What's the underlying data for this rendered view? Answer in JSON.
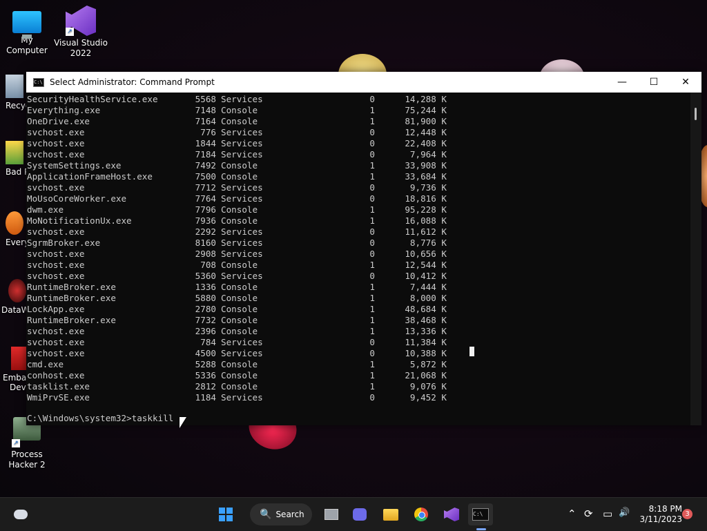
{
  "desktop": {
    "icons": [
      {
        "label_line1": "My Computer",
        "label_line2": ""
      },
      {
        "label_line1": "Visual Studio",
        "label_line2": "2022"
      },
      {
        "label_line1": "Process",
        "label_line2": "Hacker 2"
      }
    ],
    "partial_labels": [
      "Recyc",
      "Bad P",
      "Every",
      "DataW",
      "Embar",
      "Dev"
    ]
  },
  "window": {
    "title": "Select Administrator:  Command Prompt",
    "icon_glyph": "C:\\",
    "minimize_glyph": "—",
    "maximize_glyph": "☐",
    "close_glyph": "✕"
  },
  "console": {
    "rows": [
      [
        "SecurityHealthService.exe",
        "5568",
        "Services",
        "0",
        "14,288 K"
      ],
      [
        "Everything.exe",
        "7148",
        "Console",
        "1",
        "75,244 K"
      ],
      [
        "OneDrive.exe",
        "7164",
        "Console",
        "1",
        "81,900 K"
      ],
      [
        "svchost.exe",
        "776",
        "Services",
        "0",
        "12,448 K"
      ],
      [
        "svchost.exe",
        "1844",
        "Services",
        "0",
        "22,408 K"
      ],
      [
        "svchost.exe",
        "7184",
        "Services",
        "0",
        "7,964 K"
      ],
      [
        "SystemSettings.exe",
        "7492",
        "Console",
        "1",
        "33,908 K"
      ],
      [
        "ApplicationFrameHost.exe",
        "7500",
        "Console",
        "1",
        "33,684 K"
      ],
      [
        "svchost.exe",
        "7712",
        "Services",
        "0",
        "9,736 K"
      ],
      [
        "MoUsoCoreWorker.exe",
        "7764",
        "Services",
        "0",
        "18,816 K"
      ],
      [
        "dwm.exe",
        "7796",
        "Console",
        "1",
        "95,228 K"
      ],
      [
        "MoNotificationUx.exe",
        "7936",
        "Console",
        "1",
        "16,088 K"
      ],
      [
        "svchost.exe",
        "2292",
        "Services",
        "0",
        "11,612 K"
      ],
      [
        "SgrmBroker.exe",
        "8160",
        "Services",
        "0",
        "8,776 K"
      ],
      [
        "svchost.exe",
        "2908",
        "Services",
        "0",
        "10,656 K"
      ],
      [
        "svchost.exe",
        "708",
        "Console",
        "1",
        "12,544 K"
      ],
      [
        "svchost.exe",
        "5360",
        "Services",
        "0",
        "10,412 K"
      ],
      [
        "RuntimeBroker.exe",
        "1336",
        "Console",
        "1",
        "7,444 K"
      ],
      [
        "RuntimeBroker.exe",
        "5880",
        "Console",
        "1",
        "8,000 K"
      ],
      [
        "LockApp.exe",
        "2780",
        "Console",
        "1",
        "48,684 K"
      ],
      [
        "RuntimeBroker.exe",
        "7732",
        "Console",
        "1",
        "38,468 K"
      ],
      [
        "svchost.exe",
        "2396",
        "Console",
        "1",
        "13,336 K"
      ],
      [
        "svchost.exe",
        "784",
        "Services",
        "0",
        "11,384 K"
      ],
      [
        "svchost.exe",
        "4500",
        "Services",
        "0",
        "10,388 K"
      ],
      [
        "cmd.exe",
        "5288",
        "Console",
        "1",
        "5,872 K"
      ],
      [
        "conhost.exe",
        "5336",
        "Console",
        "1",
        "21,068 K"
      ],
      [
        "tasklist.exe",
        "2812",
        "Console",
        "1",
        "9,076 K"
      ],
      [
        "WmiPrvSE.exe",
        "1184",
        "Services",
        "0",
        "9,452 K"
      ]
    ],
    "prompt": "C:\\Windows\\system32>taskkill"
  },
  "taskbar": {
    "search_label": "Search",
    "search_glyph": "🔍",
    "time": "8:18 PM",
    "date": "3/11/2023",
    "notification_count": "3",
    "tray_glyphs": {
      "chevron": "⌃",
      "sync": "⟳",
      "display": "▭",
      "volume": "🔊"
    }
  }
}
